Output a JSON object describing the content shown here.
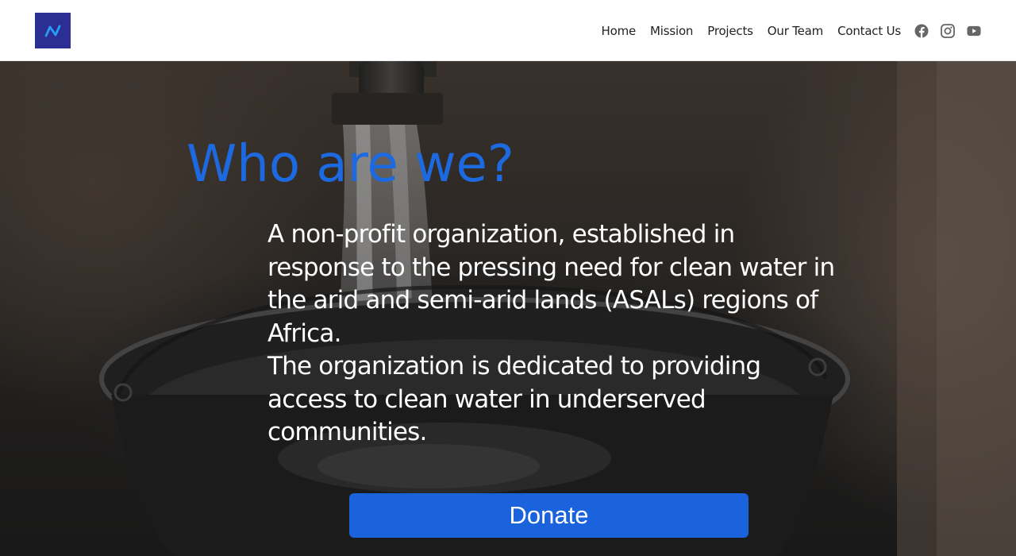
{
  "brand": {
    "logo_icon": "organization-logo-icon",
    "logo_color": "#2b2f94",
    "logo_accent": "#2a9df4"
  },
  "nav": {
    "items": [
      {
        "label": "Home"
      },
      {
        "label": "Mission"
      },
      {
        "label": "Projects"
      },
      {
        "label": "Our Team"
      },
      {
        "label": "Contact Us"
      }
    ]
  },
  "social": {
    "icons": [
      "facebook-icon",
      "instagram-icon",
      "youtube-icon"
    ],
    "icon_color": "#666666"
  },
  "hero": {
    "title": "Who are we?",
    "title_color": "#1d69e0",
    "paragraph_1": "A non-profit organization, established in response to the pressing need for clean water in the arid and semi-arid lands (ASALs) regions of Africa.",
    "paragraph_2": "The organization is dedicated to providing access to clean water in underserved communities.",
    "background_image": "water-tap-pouring-into-bucket-image"
  },
  "cta": {
    "donate_label": "Donate",
    "color": "#1a63dc"
  }
}
